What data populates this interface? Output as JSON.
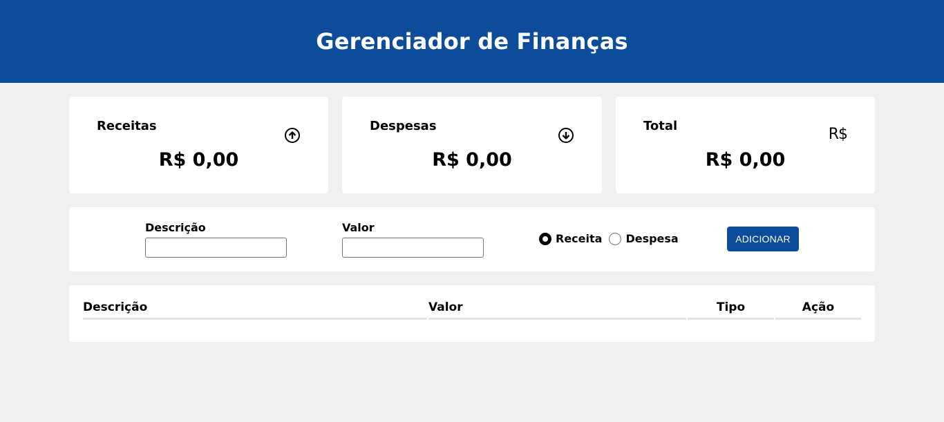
{
  "header": {
    "title": "Gerenciador de Finanças"
  },
  "cards": {
    "income": {
      "title": "Receitas",
      "amount": "R$ 0,00",
      "icon": "arrow-up-circle-icon"
    },
    "expense": {
      "title": "Despesas",
      "amount": "R$ 0,00",
      "icon": "arrow-down-circle-icon"
    },
    "total": {
      "title": "Total",
      "amount": "R$ 0,00",
      "icon_text": "R$"
    }
  },
  "form": {
    "description_label": "Descrição",
    "description_value": "",
    "value_label": "Valor",
    "value_value": "",
    "type_options": [
      {
        "label": "Receita",
        "checked": true
      },
      {
        "label": "Despesa",
        "checked": false
      }
    ],
    "add_button": "ADICIONAR"
  },
  "table": {
    "columns": [
      "Descrição",
      "Valor",
      "Tipo",
      "Ação"
    ],
    "rows": []
  },
  "colors": {
    "primary": "#0d4c9b",
    "background": "#f0f0f0",
    "card": "#ffffff"
  }
}
